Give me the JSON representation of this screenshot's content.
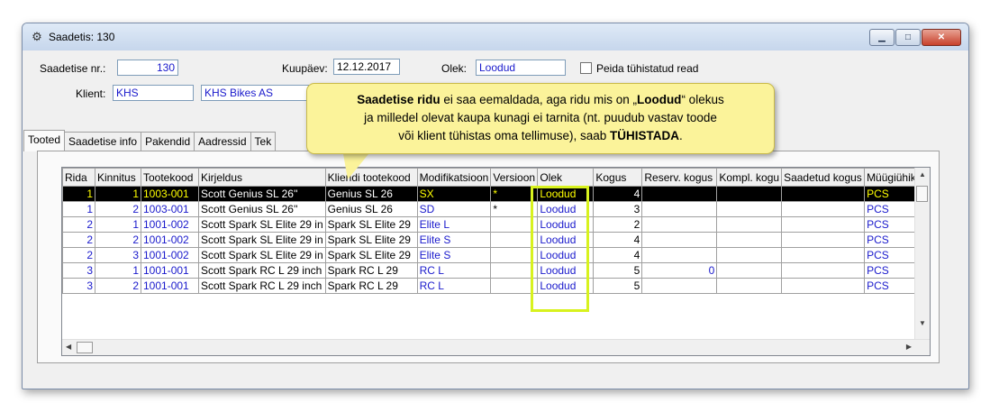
{
  "window": {
    "title": "Saadetis: 130"
  },
  "header": {
    "shipment_no_label": "Saadetise nr.:",
    "shipment_no": "130",
    "date_label": "Kuupäev:",
    "date": "12.12.2017",
    "status_label": "Olek:",
    "status": "Loodud",
    "hide_cancelled_label": "Peida tühistatud read",
    "client_label": "Klient:",
    "client_code": "KHS",
    "client_name": "KHS Bikes AS"
  },
  "tabs": [
    "Tooted",
    "Saadetise info",
    "Pakendid",
    "Aadressid",
    "Tek"
  ],
  "grid": {
    "columns": [
      "Rida",
      "Kinnitus",
      "Tootekood",
      "Kirjeldus",
      "Kliendi tootekood",
      "Modifikatsioon",
      "Versioon",
      "Olek",
      "Kogus",
      "Reserv. kogus",
      "Kompl. kogu",
      "Saadetud kogus",
      "Müügiühik"
    ],
    "rows": [
      [
        "1",
        "1",
        "1003-001",
        "Scott Genius SL 26''",
        "Genius SL 26",
        "SX",
        "*",
        "Loodud",
        "4",
        "",
        "",
        "",
        "PCS"
      ],
      [
        "1",
        "2",
        "1003-001",
        "Scott Genius SL 26''",
        "Genius SL 26",
        "SD",
        "*",
        "Loodud",
        "3",
        "",
        "",
        "",
        "PCS"
      ],
      [
        "2",
        "1",
        "1001-002",
        "Scott Spark SL Elite 29 in",
        "Spark SL Elite 29",
        "Elite L",
        "",
        "Loodud",
        "2",
        "",
        "",
        "",
        "PCS"
      ],
      [
        "2",
        "2",
        "1001-002",
        "Scott Spark SL Elite 29 in",
        "Spark SL Elite 29",
        "Elite S",
        "",
        "Loodud",
        "4",
        "",
        "",
        "",
        "PCS"
      ],
      [
        "2",
        "3",
        "1001-002",
        "Scott Spark SL Elite 29 in",
        "Spark SL Elite 29",
        "Elite S",
        "",
        "Loodud",
        "4",
        "",
        "",
        "",
        "PCS"
      ],
      [
        "3",
        "1",
        "1001-001",
        "Scott Spark RC L 29 inch",
        "Spark RC L 29",
        "RC L",
        "",
        "Loodud",
        "5",
        "0",
        "",
        "",
        "PCS"
      ],
      [
        "3",
        "2",
        "1001-001",
        "Scott Spark RC L 29 inch",
        "Spark RC L 29",
        "RC L",
        "",
        "Loodud",
        "5",
        "",
        "",
        "",
        "PCS"
      ]
    ]
  },
  "callout": {
    "p1_bold": "Saadetise ridu",
    "p1_rest": " ei saa eemaldada, aga ridu mis on „",
    "p1_bold2": "Loodud",
    "p1_end": "“ olekus",
    "line2": "ja milledel olevat kaupa kunagi ei tarnita (nt. puudub vastav toode",
    "line3_start": "või klient tühistas oma tellimuse), saab ",
    "line3_bold": "TÜHISTADA",
    "line3_end": "."
  },
  "icons": {
    "app": "gear-icon",
    "minimize": "minimize-icon",
    "maximize": "maximize-icon",
    "close": "close-icon"
  }
}
